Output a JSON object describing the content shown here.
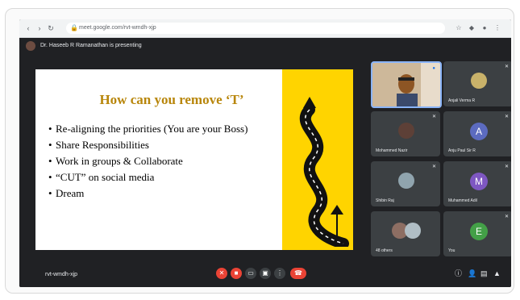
{
  "browser": {
    "url": "meet.google.com/rvt-wmdh-xjp"
  },
  "presenter_bar": {
    "text": "Dr. Haseeb R Ramanathan is presenting"
  },
  "slide": {
    "title": "How can you remove ‘T’",
    "bullets": [
      "Re-aligning the priorities (You are your Boss)",
      "Share Responsibilities",
      "Work in groups & Collaborate",
      "“CUT” on social media",
      "Dream"
    ],
    "accent_color": "#ffd400",
    "title_color": "#b8860b"
  },
  "participants": [
    {
      "name": "",
      "type": "video",
      "icon": "presenter-video"
    },
    {
      "name": "Anjali Verma R",
      "type": "photo",
      "icon": "person-photo"
    },
    {
      "name": "Mohammed Nazir",
      "type": "photo",
      "icon": "person-photo"
    },
    {
      "name": "Anju Paul Sir R",
      "type": "initial",
      "initial": "A",
      "color": "#5c6bc0"
    },
    {
      "name": "Shibin Raj",
      "type": "photo",
      "icon": "person-photo"
    },
    {
      "name": "Muhammed Adil",
      "type": "initial",
      "initial": "M",
      "color": "#7e57c2"
    },
    {
      "name": "48 others",
      "type": "group",
      "icon": "group-photos"
    },
    {
      "name": "You",
      "type": "initial",
      "initial": "E",
      "color": "#43a047"
    }
  ],
  "bottom_bar": {
    "meeting_code": "rvt-wmdh-xjp"
  }
}
